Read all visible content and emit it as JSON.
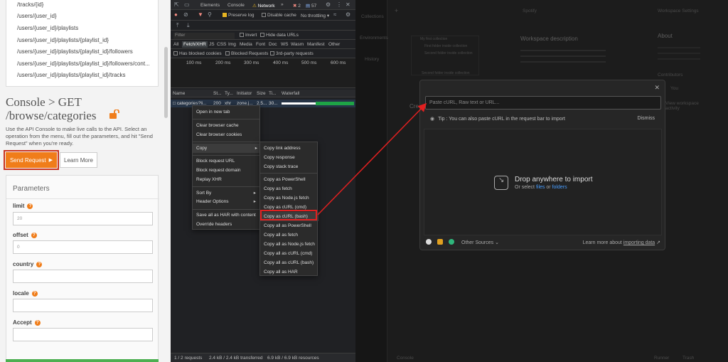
{
  "left_panel": {
    "endpoints": [
      "/tracks/{id}",
      "/users/{user_id}",
      "/users/{user_id}/playlists",
      "/users/{user_id}/playlists/{playlist_id}",
      "/users/{user_id}/playlists/{playlist_id}/followers",
      "/users/{user_id}/playlists/{playlist_id}/followers/cont...",
      "/users/{user_id}/playlists/{playlist_id}/tracks"
    ],
    "console_title": "Console > GET /browse/categories",
    "console_desc": "Use the API Console to make live calls to the API. Select an operation from the menu, fill out the parameters, and hit \"Send Request\" when you're ready.",
    "send_label": "Send Request",
    "learn_label": "Learn More",
    "params_title": "Parameters",
    "params": [
      {
        "label": "limit",
        "value": "20"
      },
      {
        "label": "offset",
        "value": "0"
      },
      {
        "label": "country",
        "value": ""
      },
      {
        "label": "locale",
        "value": ""
      },
      {
        "label": "Accept",
        "value": ""
      }
    ],
    "accent_color": "#f07d1a"
  },
  "devtools": {
    "tabs": [
      "Elements",
      "Console",
      "Network"
    ],
    "active_tab": "Network",
    "errors": "2",
    "messages": "57",
    "preserve_log": "Preserve log",
    "disable_cache": "Disable cache",
    "throttling": "No throttling",
    "filter_placeholder": "Filter",
    "invert": "Invert",
    "hide_data_urls": "Hide data URLs",
    "type_filters": [
      "All",
      "Fetch/XHR",
      "JS",
      "CSS",
      "Img",
      "Media",
      "Font",
      "Doc",
      "WS",
      "Wasm",
      "Manifest",
      "Other"
    ],
    "has_blocked_cookies": "Has blocked cookies",
    "blocked_requests": "Blocked Requests",
    "third_party": "3rd-party requests",
    "timeline_ticks": [
      "100 ms",
      "200 ms",
      "300 ms",
      "400 ms",
      "500 ms",
      "600 ms"
    ],
    "columns": [
      "Name",
      "St...",
      "Ty...",
      "Initiator",
      "Size",
      "Ti...",
      "Waterfall"
    ],
    "row": {
      "name": "categories?li...",
      "status": "200",
      "type": "xhr",
      "initiator": "zone.j...",
      "size": "2.5...",
      "time": "30..."
    },
    "status_bar": [
      "1 / 2 requests",
      "2.4 kB / 2.4 kB transferred",
      "6.9 kB / 6.9 kB resources"
    ]
  },
  "context_menu": {
    "items": [
      "Open in new tab",
      "Clear browser cache",
      "Clear browser cookies",
      "Copy",
      "Block request URL",
      "Block request domain",
      "Replay XHR",
      "Sort By",
      "Header Options",
      "Save all as HAR with content",
      "Override headers"
    ]
  },
  "copy_submenu": {
    "items": [
      "Copy link address",
      "Copy response",
      "Copy stack trace",
      "Copy as PowerShell",
      "Copy as fetch",
      "Copy as Node.js fetch",
      "Copy as cURL (cmd)",
      "Copy as cURL (bash)",
      "Copy all as PowerShell",
      "Copy all as fetch",
      "Copy all as Node.js fetch",
      "Copy all as cURL (cmd)",
      "Copy all as cURL (bash)",
      "Copy all as HAR"
    ],
    "highlighted": "Copy as cURL (bash)"
  },
  "postman": {
    "bg_title": "Spotify",
    "workspace_settings": "Workspace Settings",
    "workspace_desc": "Workspace description",
    "sidebar": [
      "Collections",
      "Environments",
      "History"
    ],
    "about": "About",
    "contributors": "Contributors",
    "you": "You",
    "view_workspace": "View workspace activity",
    "tree": [
      "My first collection",
      "First folder inside collection",
      "Second folder inside collection",
      "Second folder inside collection"
    ],
    "console": "Console",
    "runner": "Runner",
    "trash": "Trash",
    "cre": "Cre"
  },
  "import_modal": {
    "placeholder": "Paste cURL, Raw text or URL...",
    "tip": "Tip : You can also paste cURL in the request bar to import",
    "dismiss": "Dismiss",
    "drop_title": "Drop anywhere to import",
    "drop_prefix": "Or select",
    "drop_files": "files",
    "drop_or": "or",
    "drop_folders": "folders",
    "other_sources": "Other Sources",
    "learn_more": "Learn more about",
    "importing_data": "importing data"
  }
}
